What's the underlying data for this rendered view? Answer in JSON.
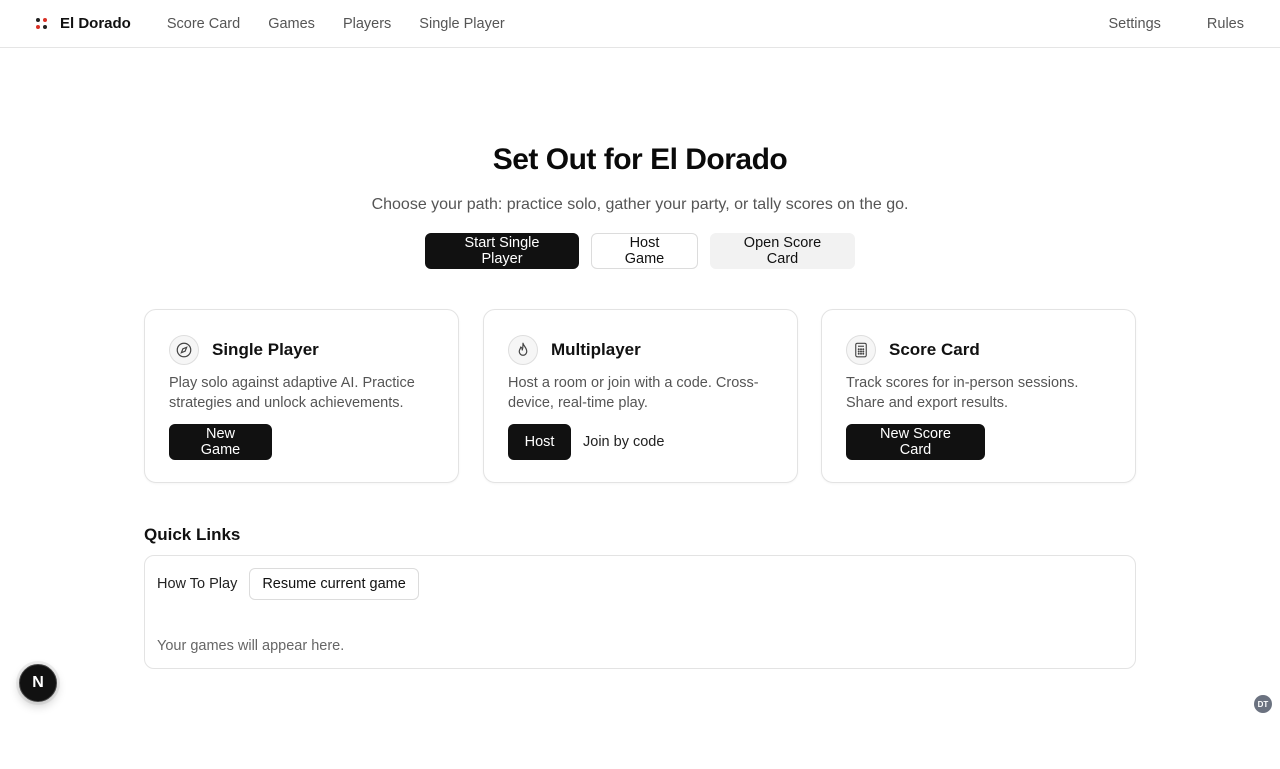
{
  "header": {
    "brand": "El Dorado",
    "nav": [
      "Score Card",
      "Games",
      "Players",
      "Single Player"
    ],
    "nav_right": [
      "Settings",
      "Rules"
    ]
  },
  "hero": {
    "title": "Set Out for El Dorado",
    "subtitle": "Choose your path: practice solo, gather your party, or tally scores on the go.",
    "actions": {
      "primary": "Start Single Player",
      "secondary": "Host Game",
      "tertiary": "Open Score Card"
    }
  },
  "cards": [
    {
      "icon": "compass-icon",
      "title": "Single Player",
      "text": "Play solo against adaptive AI. Practice strategies and unlock achievements.",
      "primary_action": "New Game"
    },
    {
      "icon": "flame-icon",
      "title": "Multiplayer",
      "text": "Host a room or join with a code. Cross-device, real-time play.",
      "primary_action": "Host",
      "secondary_action": "Join by code"
    },
    {
      "icon": "calculator-icon",
      "title": "Score Card",
      "text": "Track scores for in-person sessions. Share and export results.",
      "primary_action": "New Score Card"
    }
  ],
  "quick_links": {
    "title": "Quick Links",
    "how_to_play": "How To Play",
    "resume": "Resume current game",
    "empty": "Your games will appear here."
  },
  "floating": {
    "fab_letter": "N",
    "devtools_badge": "DT"
  },
  "colors": {
    "primary": "#111111",
    "logo_red": "#d93025",
    "logo_dark": "#222222"
  }
}
